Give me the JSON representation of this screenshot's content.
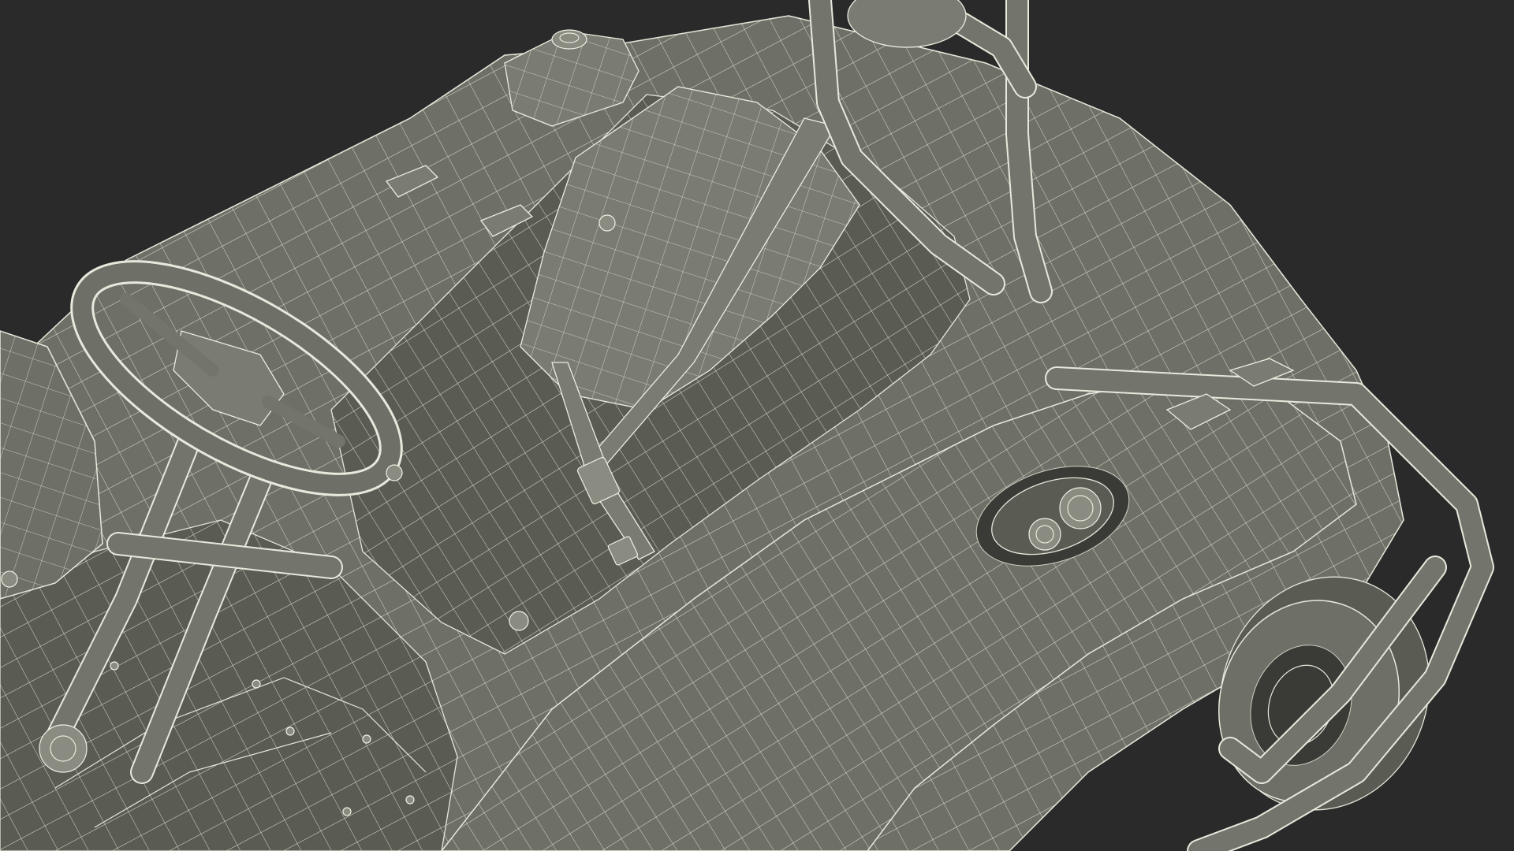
{
  "scene": {
    "subject": "go-kart-wireframe-render",
    "background_color": "#2a2a2a",
    "body_color": "#6e6f66",
    "wire_color": "#e8e8dc"
  }
}
